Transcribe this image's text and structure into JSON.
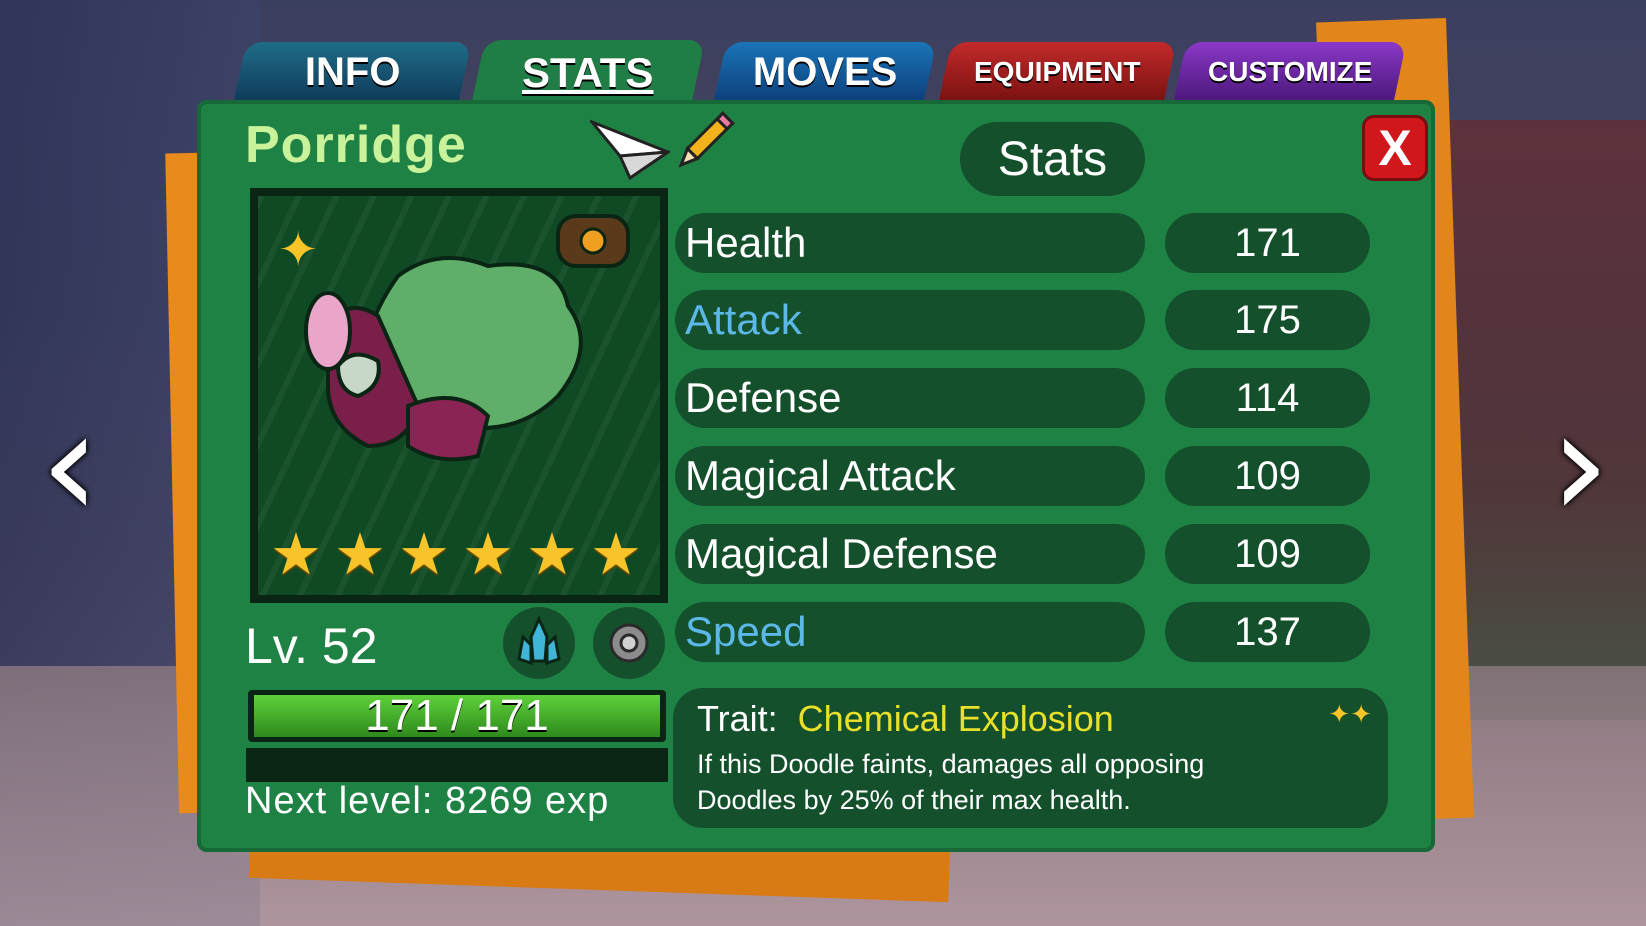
{
  "tabs": [
    {
      "label": "INFO"
    },
    {
      "label": "STATS"
    },
    {
      "label": "MOVES"
    },
    {
      "label": "EQUIPMENT"
    },
    {
      "label": "CUSTOMIZE"
    }
  ],
  "doodle": {
    "name": "Porridge",
    "level": "Lv. 52",
    "hp_text": "171 / 171",
    "hp_fraction": 1.0,
    "star_count": 6,
    "next_level": "Next level: 8269 exp"
  },
  "stats_title": "Stats",
  "close_label": "X",
  "stats": [
    {
      "name": "Health",
      "value": "171",
      "highlight": false
    },
    {
      "name": "Attack",
      "value": "175",
      "highlight": true
    },
    {
      "name": "Defense",
      "value": "114",
      "highlight": false
    },
    {
      "name": "Magical Attack",
      "value": "109",
      "highlight": false
    },
    {
      "name": "Magical Defense",
      "value": "109",
      "highlight": false
    },
    {
      "name": "Speed",
      "value": "137",
      "highlight": true
    }
  ],
  "trait": {
    "label": "Trait:",
    "name": "Chemical Explosion",
    "desc_line1": "If this Doodle faints, damages all opposing",
    "desc_line2": "Doodles by 25% of their max health."
  },
  "nav": {
    "prev": "‹",
    "next": "›"
  },
  "colors": {
    "panel": "#1f8245",
    "pill": "#14502b",
    "highlight_stat": "#5bb8e8",
    "trait_name": "#e8e02a",
    "star": "#f7c52a",
    "close": "#d0171c"
  }
}
